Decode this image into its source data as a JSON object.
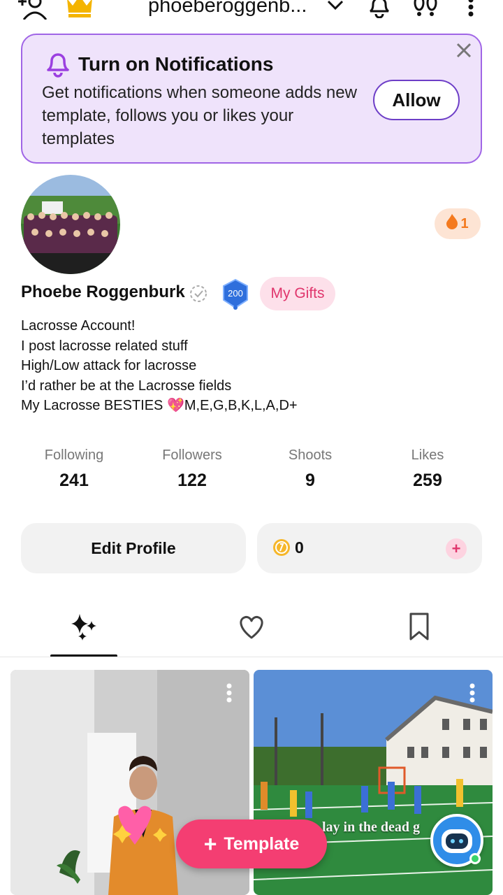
{
  "header": {
    "username": "phoeberoggenb...",
    "icons": [
      "add-user-icon",
      "crown-icon",
      "chevron-down-icon",
      "bell-icon",
      "footprints-icon",
      "more-vertical-icon"
    ]
  },
  "notification": {
    "title": "Turn on Notifications",
    "body": "Get notifications when someone adds new template, follows you or likes your templates",
    "allow_label": "Allow"
  },
  "profile": {
    "streak_count": "1",
    "name": "Phoebe Roggenburk",
    "level": "200",
    "gifts_label": "My Gifts",
    "bio": [
      "Lacrosse Account!",
      "I post lacrosse related stuff",
      "High/Low attack for lacrosse",
      "I’d rather be at the Lacrosse fields",
      "My Lacrosse BESTIES 💖M,E,G,B,K,L,A,D+"
    ]
  },
  "stats": [
    {
      "label": "Following",
      "value": "241"
    },
    {
      "label": "Followers",
      "value": "122"
    },
    {
      "label": "Shoots",
      "value": "9"
    },
    {
      "label": "Likes",
      "value": "259"
    }
  ],
  "actions": {
    "edit_label": "Edit Profile",
    "coins": "0"
  },
  "tabs": [
    "sparkles-icon",
    "heart-icon",
    "bookmark-icon"
  ],
  "posts": [
    {
      "overlay": ""
    },
    {
      "overlay": "lay in the dead g"
    }
  ],
  "fab": {
    "label": "Template"
  },
  "colors": {
    "accent": "#f43e72",
    "banner_bg": "#efe3fb",
    "banner_border": "#a065e6"
  }
}
